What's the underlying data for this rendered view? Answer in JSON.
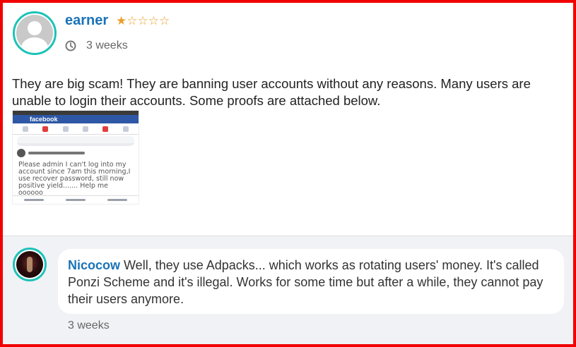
{
  "review": {
    "username": "earner",
    "rating": {
      "value": 1,
      "max": 5,
      "stars_text": "★☆☆☆☆"
    },
    "time_ago": "3 weeks",
    "text": "They are big scam! They are banning user accounts without any reasons. Many users are unable to login their accounts. Some proofs are attached below.",
    "attachment": {
      "app_label": "facebook",
      "post_text": "Please admin I can't log into my account since 7am this morning,I use recover password, still now positive yield....... Help me oooooo"
    }
  },
  "reply": {
    "username": "Nicocow",
    "text": " Well, they use Adpacks... which works as rotating users' money. It's called Ponzi Scheme and it's illegal. Works for some time but after a while, they cannot pay their users anymore.",
    "time_ago": "3 weeks"
  },
  "colors": {
    "frame_border": "#f10000",
    "link_blue": "#1a73b8",
    "avatar_ring": "#1cc2b8",
    "star": "#e8a12d",
    "reply_background": "#f0f2f5"
  },
  "icons": [
    "default-user-avatar-icon",
    "clock-icon",
    "star-icon"
  ]
}
